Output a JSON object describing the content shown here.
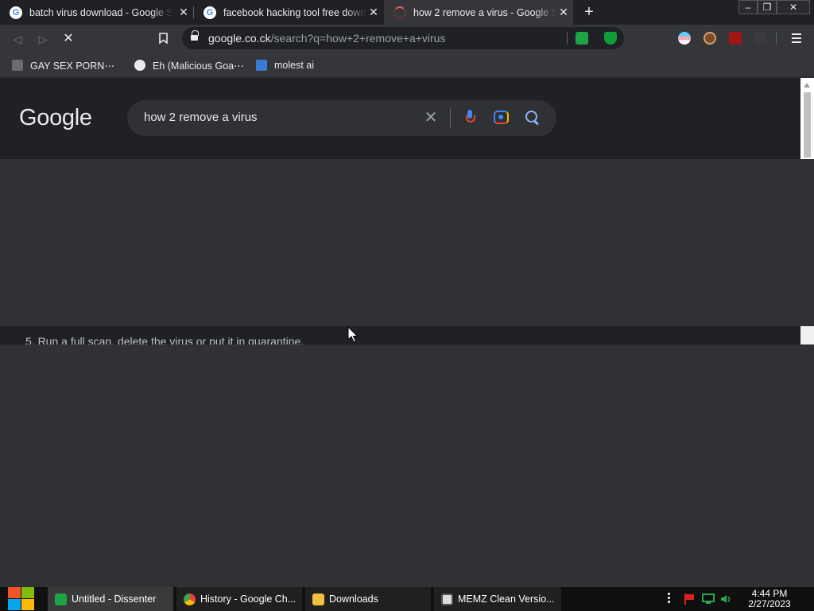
{
  "tabs": [
    {
      "title": "batch virus download - Google S",
      "close": "✕",
      "active": false
    },
    {
      "title": "facebook hacking tool free down",
      "close": "✕",
      "active": false
    },
    {
      "title": "how 2 remove a virus - Google S",
      "close": "✕",
      "active": true
    }
  ],
  "new_tab": "+",
  "window_controls": {
    "minimize": "–",
    "restore": "❐",
    "close": "✕"
  },
  "toolbar": {
    "back": "◁",
    "forward": "▷",
    "stop": "✕",
    "bookmark_icon": "bookmark-icon",
    "url_host": "google.co.ck",
    "url_path": "/search?q=how+2+remove+a+virus"
  },
  "bookmarks": [
    {
      "label": "GAY SEX PORN⋯"
    },
    {
      "label": "Eh (Malicious Goa⋯"
    },
    {
      "label": "molest ai"
    }
  ],
  "google": {
    "logo": "Google",
    "query": "how 2 remove a virus",
    "clear": "✕"
  },
  "content": {
    "snippet": "5. Run a full scan, delete the virus or put it in quarantine."
  },
  "taskbar": {
    "items": [
      {
        "label": "Untitled - Dissenter"
      },
      {
        "label": "History - Google Ch..."
      },
      {
        "label": "Downloads"
      },
      {
        "label": "MEMZ Clean Versio..."
      }
    ],
    "time": "4:44 PM",
    "date": "2/27/2023"
  },
  "colors": {
    "page_bg": "#303134",
    "header_bg": "#202124",
    "accent_blue": "#8ab4f8"
  }
}
